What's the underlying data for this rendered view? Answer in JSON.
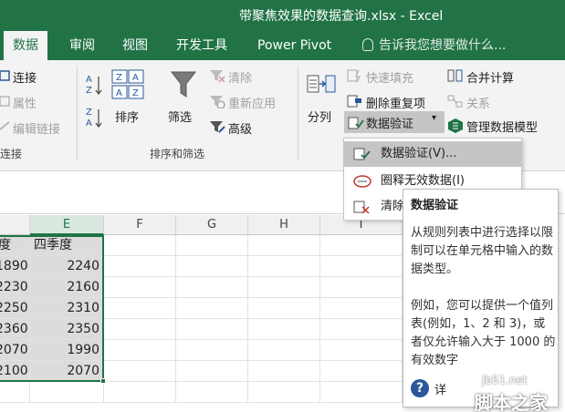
{
  "window": {
    "title": "带聚焦效果的数据查询.xlsx - Excel"
  },
  "tabs": [
    {
      "label": "数据",
      "active": true
    },
    {
      "label": "审阅"
    },
    {
      "label": "视图"
    },
    {
      "label": "开发工具"
    },
    {
      "label": "Power Pivot"
    }
  ],
  "tell_me": "告诉我您想要做什么...",
  "ribbon": {
    "connections": {
      "connect": "连接",
      "properties": "属性",
      "edit_links": "编辑链接",
      "group_label_partial": "连接"
    },
    "sort_filter": {
      "sort": "排序",
      "filter": "筛选",
      "clear": "清除",
      "reapply": "重新应用",
      "advanced": "高级",
      "group_label": "排序和筛选"
    },
    "data_tools": {
      "split": "分列",
      "flash_fill": "快速填充",
      "remove_duplicates": "删除重复项",
      "data_validation": "数据验证",
      "consolidate": "合并计算",
      "relationships": "关系",
      "manage_model": "管理数据模型"
    }
  },
  "dropdown": {
    "items": [
      {
        "label": "数据验证(V)..."
      },
      {
        "label": "圈释无效数据(I)"
      },
      {
        "label": "清除"
      }
    ]
  },
  "tooltip": {
    "title": "数据验证",
    "para1": "从规则列表中进行选择以限制可以在单元格中输入的数据类型。",
    "para2": "例如，您可以提供一个值列表(例如，1、2 和 3)，或者仅允许输入大于 1000 的有效数字",
    "help_partial": "详"
  },
  "grid": {
    "columns": [
      "E",
      "F",
      "G",
      "H",
      "I"
    ],
    "header_row": {
      "d": "度",
      "e": "四季度"
    },
    "rows": [
      {
        "d": "1890",
        "e": "2240"
      },
      {
        "d": "2230",
        "e": "2160"
      },
      {
        "d": "2250",
        "e": "2310"
      },
      {
        "d": "2360",
        "e": "2350"
      },
      {
        "d": "2070",
        "e": "1990"
      },
      {
        "d": "2100",
        "e": "2070"
      }
    ]
  },
  "watermark": {
    "site": "jb51.net",
    "brand": "脚本之家"
  },
  "colors": {
    "excel_green": "#217346",
    "ribbon_bg": "#f3f3f3",
    "selection": "#dcdcdc"
  }
}
